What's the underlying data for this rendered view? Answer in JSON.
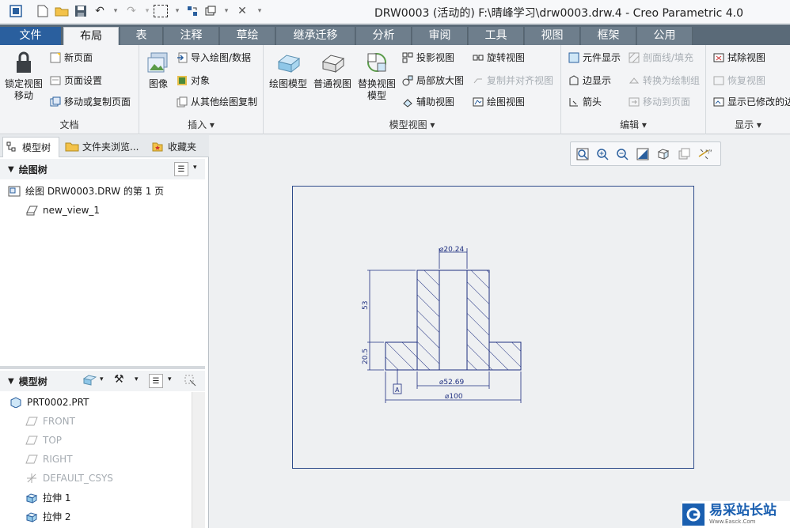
{
  "window": {
    "title": "DRW0003 (活动的) F:\\晴峰学习\\drw0003.drw.4 - Creo Parametric 4.0"
  },
  "ribbon_tabs": [
    {
      "label": "文件"
    },
    {
      "label": "布局"
    },
    {
      "label": "表"
    },
    {
      "label": "注释"
    },
    {
      "label": "草绘"
    },
    {
      "label": "继承迁移"
    },
    {
      "label": "分析"
    },
    {
      "label": "审阅"
    },
    {
      "label": "工具"
    },
    {
      "label": "视图"
    },
    {
      "label": "框架"
    },
    {
      "label": "公用"
    }
  ],
  "groups": {
    "document": {
      "label": "文档",
      "lock_view": "锁定视图\n移动",
      "new_page": "新页面",
      "page_setup": "页面设置",
      "move_copy_page": "移动或复制页面"
    },
    "insert": {
      "label": "插入",
      "image": "图像",
      "import_drawing": "导入绘图/数据",
      "object": "对象",
      "copy_from_drawing": "从其他绘图复制"
    },
    "model_views": {
      "label": "模型视图",
      "drawing_model": "绘图模型",
      "general_view": "普通视图",
      "replace_view": "替换视图\n模型",
      "projection_view": "投影视图",
      "detail_view": "局部放大图",
      "auxiliary_view": "辅助视图",
      "revolved_view": "旋转视图",
      "copy_align_view": "复制并对齐视图",
      "drawing_view": "绘图视图"
    },
    "edit": {
      "label": "编辑",
      "element_display": "元件显示",
      "edge_display": "边显示",
      "arrow": "箭头",
      "section_fill": "剖面线/填充",
      "convert_to_draw": "转换为绘制组",
      "move_to_page": "移动到页面"
    },
    "display": {
      "label": "显示",
      "erase_view": "拭除视图",
      "resume_view": "恢复视图",
      "show_modified": "显示已修改的边"
    }
  },
  "panel_tabs": [
    {
      "label": "模型树"
    },
    {
      "label": "文件夹浏览..."
    },
    {
      "label": "收藏夹"
    }
  ],
  "drawing_tree": {
    "header": "绘图树",
    "items": [
      {
        "label": "绘图 DRW0003.DRW 的第 1 页"
      },
      {
        "label": "new_view_1"
      }
    ]
  },
  "model_tree": {
    "header": "模型树",
    "items": [
      {
        "label": "PRT0002.PRT"
      },
      {
        "label": "FRONT"
      },
      {
        "label": "TOP"
      },
      {
        "label": "RIGHT"
      },
      {
        "label": "DEFAULT_CSYS"
      },
      {
        "label": "拉伸 1"
      },
      {
        "label": "拉伸 2"
      }
    ]
  },
  "drawing": {
    "dim_top": "⌀20.24",
    "dim_height": "53",
    "dim_base": "20.5",
    "dim_mid": "⌀52.69",
    "dim_total": "⌀100",
    "datum": "A"
  },
  "watermark": {
    "text": "易采站长站",
    "sub": "Www.Easck.Com"
  },
  "colors": {
    "file_tab": "#2a5f9e",
    "tab_bar": "#5a6a78",
    "sheet_border": "#2d4b8a",
    "drawing_line": "#1f2f80"
  }
}
